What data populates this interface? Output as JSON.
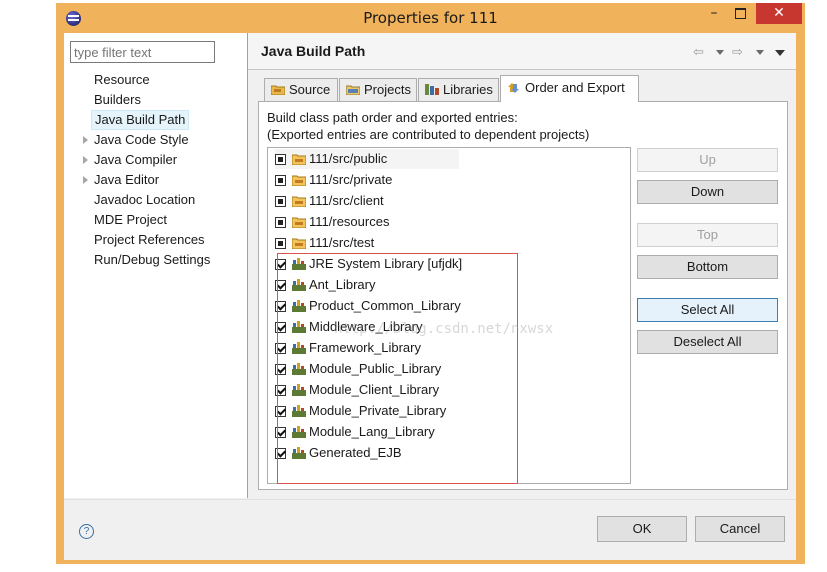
{
  "window": {
    "title": "Properties for 111",
    "minimize_glyph": "–",
    "close_glyph": "✕"
  },
  "sidebar": {
    "filter_placeholder": "type filter text",
    "items": [
      {
        "label": "Resource",
        "expandable": false,
        "selected": false
      },
      {
        "label": "Builders",
        "expandable": false,
        "selected": false
      },
      {
        "label": "Java Build Path",
        "expandable": false,
        "selected": true
      },
      {
        "label": "Java Code Style",
        "expandable": true,
        "selected": false
      },
      {
        "label": "Java Compiler",
        "expandable": true,
        "selected": false
      },
      {
        "label": "Java Editor",
        "expandable": true,
        "selected": false
      },
      {
        "label": "Javadoc Location",
        "expandable": false,
        "selected": false
      },
      {
        "label": "MDE Project",
        "expandable": false,
        "selected": false
      },
      {
        "label": "Project References",
        "expandable": false,
        "selected": false
      },
      {
        "label": "Run/Debug Settings",
        "expandable": false,
        "selected": false
      }
    ]
  },
  "page": {
    "title": "Java Build Path",
    "nav_back": "⇦",
    "nav_forward": "⇨",
    "tabs": [
      {
        "label": "Source",
        "icon": "source-folder-icon",
        "active": false
      },
      {
        "label": "Projects",
        "icon": "projects-icon",
        "active": false
      },
      {
        "label": "Libraries",
        "icon": "libraries-icon",
        "active": false
      },
      {
        "label": "Order and Export",
        "icon": "order-export-icon",
        "active": true
      }
    ],
    "description_line1": "Build class path order and exported entries:",
    "description_line2": "(Exported entries are contributed to dependent projects)",
    "entries": [
      {
        "label": "111/src/public",
        "type": "folder",
        "checked": false
      },
      {
        "label": "111/src/private",
        "type": "folder",
        "checked": false
      },
      {
        "label": "111/src/client",
        "type": "folder",
        "checked": false
      },
      {
        "label": "111/resources",
        "type": "folder",
        "checked": false
      },
      {
        "label": "111/src/test",
        "type": "folder",
        "checked": false
      },
      {
        "label": "JRE System Library [ufjdk]",
        "type": "library",
        "checked": true
      },
      {
        "label": "Ant_Library",
        "type": "library",
        "checked": true
      },
      {
        "label": "Product_Common_Library",
        "type": "library",
        "checked": true
      },
      {
        "label": "Middleware_Library",
        "type": "library",
        "checked": true
      },
      {
        "label": "Framework_Library",
        "type": "library",
        "checked": true
      },
      {
        "label": "Module_Public_Library",
        "type": "library",
        "checked": true
      },
      {
        "label": "Module_Client_Library",
        "type": "library",
        "checked": true
      },
      {
        "label": "Module_Private_Library",
        "type": "library",
        "checked": true
      },
      {
        "label": "Module_Lang_Library",
        "type": "library",
        "checked": true
      },
      {
        "label": "Generated_EJB",
        "type": "library",
        "checked": true
      }
    ],
    "buttons": {
      "up": "Up",
      "down": "Down",
      "top": "Top",
      "bottom": "Bottom",
      "select_all": "Select All",
      "deselect_all": "Deselect All"
    },
    "watermark": "http://blog.csdn.net/nxwsx"
  },
  "footer": {
    "help_glyph": "?",
    "ok": "OK",
    "cancel": "Cancel"
  },
  "colors": {
    "window_frame": "#f0b25a",
    "close_button": "#c7372f",
    "highlight_box": "#d9534f",
    "selection": "#e5f3fb"
  }
}
